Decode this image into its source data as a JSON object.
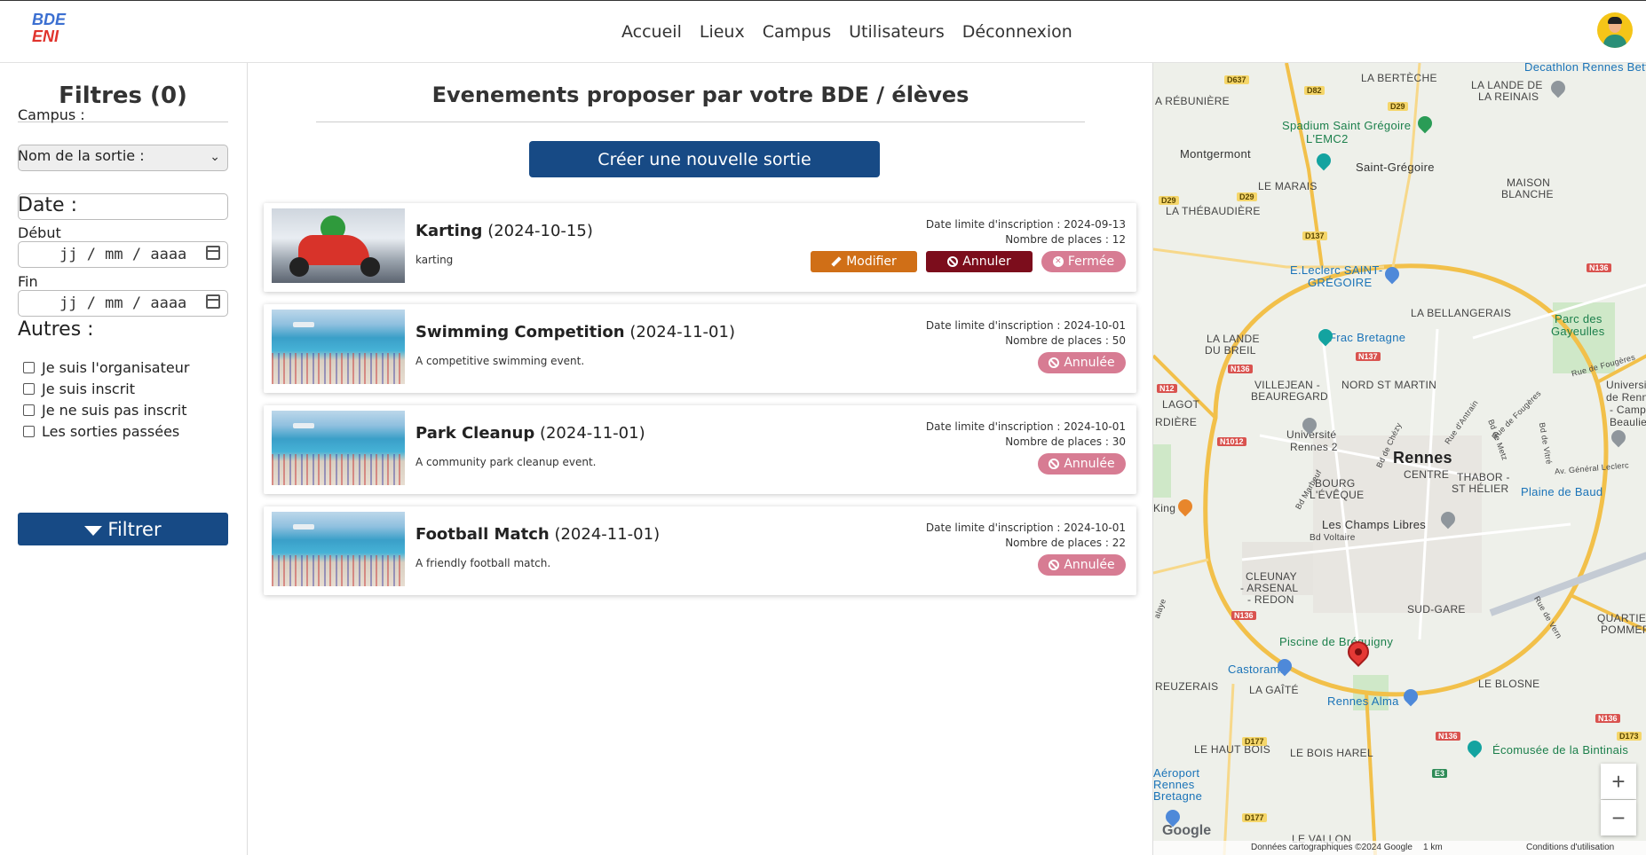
{
  "navbar": {
    "logo_line1": "BDE",
    "logo_line2": "ENI",
    "links": [
      "Accueil",
      "Lieux",
      "Campus",
      "Utilisateurs",
      "Déconnexion"
    ]
  },
  "sidebar": {
    "title": "Filtres (0)",
    "campus_label": "Campus :",
    "campus_value": "",
    "name_label": "Nom de la sortie :",
    "name_value": "",
    "date_heading": "Date :",
    "start_label": "Début",
    "end_label": "Fin",
    "date_placeholder": "jj / mm / aaaa",
    "others_heading": "Autres :",
    "checkboxes": [
      "Je suis l'organisateur",
      "Je suis inscrit",
      "Je ne suis pas inscrit",
      "Les sorties passées"
    ],
    "filter_button": "Filtrer"
  },
  "main": {
    "title": "Evenements proposer par votre BDE / élèves",
    "create_button": "Créer une nouvelle sortie",
    "deadline_prefix": "Date limite d'inscription : ",
    "places_prefix": "Nombre de places : ",
    "events": [
      {
        "name": "Karting",
        "date": "(2024-10-15)",
        "description": "karting",
        "deadline": "2024-09-13",
        "places": "12",
        "image": "karting",
        "modify_label": "Modifier",
        "cancel_label": "Annuler",
        "status": "Fermée"
      },
      {
        "name": "Swimming Competition",
        "date": "(2024-11-01)",
        "description": "A competitive swimming event.",
        "deadline": "2024-10-01",
        "places": "50",
        "image": "beach",
        "status": "Annulée"
      },
      {
        "name": "Park Cleanup",
        "date": "(2024-11-01)",
        "description": "A community park cleanup event.",
        "deadline": "2024-10-01",
        "places": "30",
        "image": "beach",
        "status": "Annulée"
      },
      {
        "name": "Football Match",
        "date": "(2024-11-01)",
        "description": "A friendly football match.",
        "deadline": "2024-10-01",
        "places": "22",
        "image": "beach",
        "status": "Annulée"
      }
    ]
  },
  "map": {
    "labels": {
      "decathlon": "Decathlon Rennes Betton",
      "berteche": "LA BERTÈCHE",
      "lande_reinais1": "LA LANDE DE",
      "lande_reinais2": "LA REINAIS",
      "rebuniere": "A RÉBUNIÈRE",
      "spadium1": "Spadium Saint Grégoire",
      "spadium2": "L'EMC2",
      "montgermont": "Montgermont",
      "saint_gregoire": "Saint-Grégoire",
      "le_marais": "LE MARAIS",
      "maison_blanche1": "MAISON",
      "maison_blanche2": "BLANCHE",
      "thebaudiere": "LA THÉBAUDIÈRE",
      "leclerc1": "E.Leclerc SAINT-",
      "leclerc2": "GRÉGOIRE",
      "bellangerais": "LA BELLANGERAIS",
      "parc_gayeulles1": "Parc des",
      "parc_gayeulles2": "Gayeulles",
      "frac": "Frac Bretagne",
      "lande_breil1": "LA LANDE",
      "lande_breil2": "DU BREIL",
      "nord_st_martin": "NORD ST MARTIN",
      "villejean1": "VILLEJEAN -",
      "villejean2": "BEAUREGARD",
      "lagot": "LAGOT",
      "rdiere": "RDIÈRE",
      "univ_rennes2a": "Université",
      "univ_rennes2b": "Rennes 2",
      "rennes": "Rennes",
      "centre": "CENTRE",
      "thabor1": "THABOR -",
      "thabor2": "ST HÉLIER",
      "plaine_baud": "Plaine de Baud",
      "bourg_leveque1": "BOURG",
      "bourg_leveque2": "L'ÉVÊQUE",
      "king": "King",
      "champs_libres": "Les Champs Libres",
      "bd_voltaire": "Bd Voltaire",
      "cleunay1": "CLEUNAY",
      "cleunay2": "- ARSENAL",
      "cleunay3": "- REDON",
      "sud_gare": "SUD-GARE",
      "quartier1": "QUARTIER",
      "quartier2": "POMMER",
      "piscine": "Piscine de Bréquigny",
      "castorama": "Castorama",
      "reuzerais": "REUZERAIS",
      "la_gaite": "LA GAÎTÉ",
      "le_blosne": "LE BLOSNE",
      "rennes_alma": "Rennes Alma",
      "haut_bois": "LE HAUT BOIS",
      "bois_harel": "LE BOIS HAREL",
      "ecomusee": "Écomusée de la Bintinais",
      "aeroport1": "Aéroport",
      "aeroport2": "Rennes",
      "aeroport3": "Bretagne",
      "le_vallon": "LE VALLON",
      "univ_rennes_right1": "Universit",
      "univ_rennes_right2": "de Renne",
      "univ_rennes_right3": "- Campu",
      "univ_rennes_right4": "Beaulieu"
    },
    "roads": {
      "d637": "D637",
      "d82": "D82",
      "d29a": "D29",
      "d29b": "D29",
      "d29c": "D29",
      "d137": "D137",
      "n136a": "N136",
      "n136b": "N136",
      "n136c": "N136",
      "n136d": "N136",
      "n136e": "N136",
      "n137": "N137",
      "n12": "N12",
      "n1012": "N1012",
      "d177a": "D177",
      "d177b": "D177",
      "d173": "D173",
      "e3": "E3"
    },
    "streets": {
      "rue_fougeres1": "Rue de Fougères",
      "rue_fougeres2": "Rue de Fougères",
      "rue_antrain": "Rue d'Antrain",
      "bd_chezy": "Bd de Chézy",
      "bd_metz": "Bd de Metz",
      "bd_vitre": "Bd de Vitré",
      "av_leclerc": "Av. Général Leclerc",
      "bd_marbeuf": "Bd Marbeuf",
      "rue_vern": "Rue de Vern",
      "rue_laval": "alaye"
    },
    "google": "Google",
    "footer_data": "Données cartographiques ©2024 Google",
    "footer_scale": "1 km",
    "footer_terms": "Conditions d'utilisation",
    "zoom_in": "+",
    "zoom_out": "−"
  }
}
